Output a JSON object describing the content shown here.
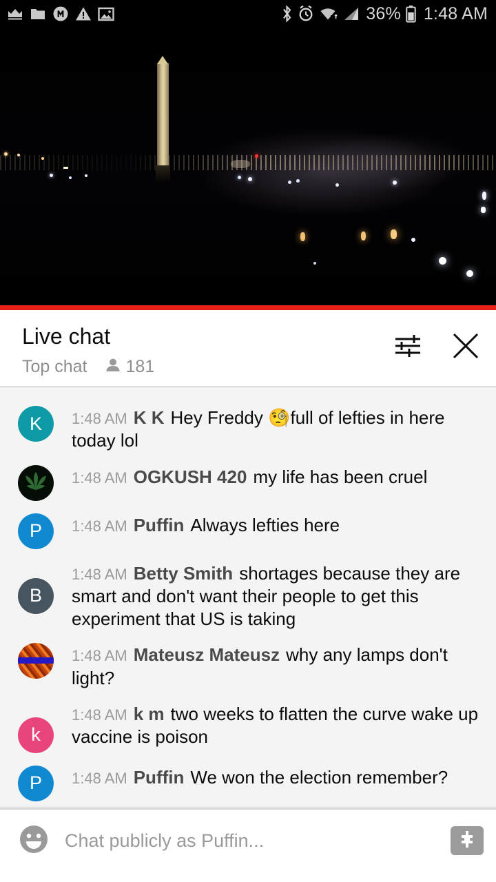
{
  "statusbar": {
    "left_icons": [
      "crown-icon",
      "folder-icon",
      "m-circle-icon",
      "warning-triangle-icon",
      "image-icon"
    ],
    "right_icons": [
      "bluetooth-icon",
      "alarm-icon",
      "wifi-icon",
      "cellular-signal-icon",
      "battery-icon"
    ],
    "battery_percent": "36%",
    "time": "1:48 AM"
  },
  "video": {
    "scene": "washington-monument-night-webcam",
    "progress_color": "#e62117",
    "progress_percent": 100
  },
  "chat_header": {
    "title": "Live chat",
    "mode": "Top chat",
    "viewer_icon": "person-icon",
    "viewer_count": "181",
    "tune_icon": "tune-icon",
    "close_icon": "close-icon"
  },
  "messages": [
    {
      "avatar_letter": "K",
      "avatar_color": "#0e9aa7",
      "avatar_type": "letter",
      "time": "1:48 AM",
      "author": "K K",
      "text_before_emoji": "Hey Freddy ",
      "emoji": "🧐",
      "text": "full of lefties in here today lol"
    },
    {
      "avatar_letter": "",
      "avatar_color": "#060d06",
      "avatar_type": "leaf",
      "time": "1:48 AM",
      "author": "OGKUSH 420",
      "text": "my life has been cruel"
    },
    {
      "avatar_letter": "P",
      "avatar_color": "#1189d0",
      "avatar_type": "letter",
      "time": "1:48 AM",
      "author": "Puffin",
      "text": "Always lefties here"
    },
    {
      "avatar_letter": "B",
      "avatar_color": "#465560",
      "avatar_type": "letter",
      "time": "1:48 AM",
      "author": "Betty Smith",
      "text": "shortages because they are smart and don't want their people to get this experiment that US is taking"
    },
    {
      "avatar_letter": "",
      "avatar_color": "#d4551a",
      "avatar_type": "photo",
      "time": "1:48 AM",
      "author": "Mateusz Mateusz",
      "text": "why any lamps don't light?"
    },
    {
      "avatar_letter": "k",
      "avatar_color": "#e8457c",
      "avatar_type": "letter",
      "time": "1:48 AM",
      "author": "k m",
      "text": "two weeks to flatten the curve wake up vaccine is poison"
    },
    {
      "avatar_letter": "P",
      "avatar_color": "#1189d0",
      "avatar_type": "letter",
      "time": "1:48 AM",
      "author": "Puffin",
      "text": "We won the election remember?"
    }
  ],
  "input_bar": {
    "emoji_icon": "emoji-smiley-icon",
    "placeholder": "Chat publicly as Puffin...",
    "superchat_icon": "dollar-sign-icon"
  }
}
